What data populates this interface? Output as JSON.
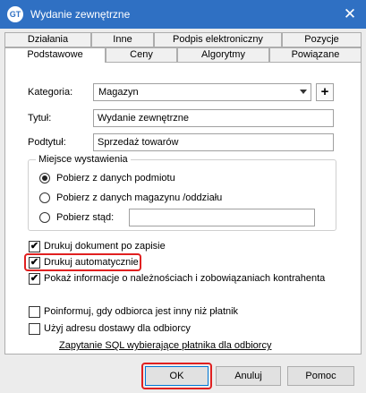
{
  "window": {
    "app_icon_text": "GT",
    "title": "Wydanie zewnętrzne",
    "close_glyph": "✕"
  },
  "tabs_top": [
    "Działania",
    "Inne",
    "Podpis elektroniczny",
    "Pozycje"
  ],
  "tabs_bottom": [
    "Podstawowe",
    "Ceny",
    "Algorytmy",
    "Powiązane"
  ],
  "active_tab": "Podstawowe",
  "form": {
    "kategoria_label": "Kategoria:",
    "kategoria_value": "Magazyn",
    "plus_glyph": "+",
    "tytul_label": "Tytuł:",
    "tytul_value": "Wydanie zewnętrzne",
    "podtytul_label": "Podtytuł:",
    "podtytul_value": "Sprzedaż towarów"
  },
  "miejsce": {
    "legend": "Miejsce wystawienia",
    "options": [
      "Pobierz z danych podmiotu",
      "Pobierz z danych magazynu /oddziału",
      "Pobierz stąd:"
    ],
    "selected_index": 0,
    "pobierz_stad_value": ""
  },
  "checks": [
    {
      "label": "Drukuj dokument po zapisie",
      "checked": true
    },
    {
      "label": "Drukuj automatycznie",
      "checked": true
    },
    {
      "label": "Pokaż informacje o należnościach i zobowiązaniach kontrahenta",
      "checked": true
    },
    {
      "label": "Poinformuj, gdy odbiorca jest inny niż płatnik",
      "checked": false
    },
    {
      "label": "Użyj adresu dostawy dla odbiorcy",
      "checked": false
    }
  ],
  "check_glyph": "✔",
  "sql_link": "Zapytanie SQL wybierające płatnika dla odbiorcy",
  "buttons": {
    "ok": "OK",
    "cancel": "Anuluj",
    "help": "Pomoc"
  },
  "colors": {
    "title_bar": "#2f70c3",
    "highlight": "#e02020",
    "default_button_border": "#0078d7"
  }
}
